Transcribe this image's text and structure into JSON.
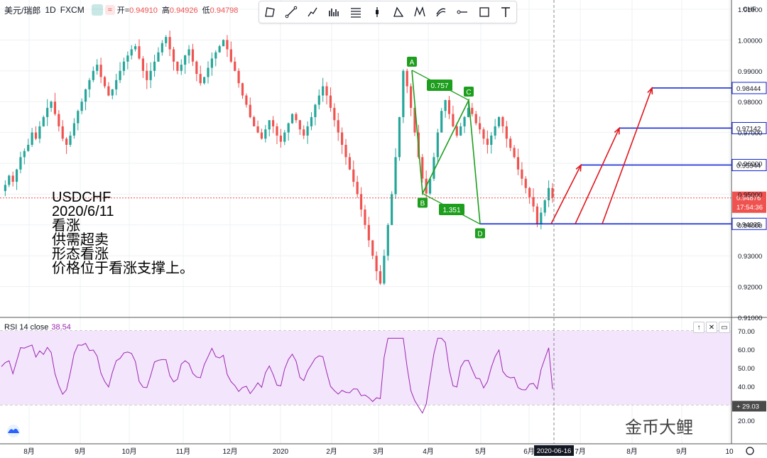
{
  "header": {
    "symbol": "美元/瑞郎",
    "interval": "1D",
    "source": "FXCM",
    "open_label": "开",
    "open": "0.94910",
    "high_label": "高",
    "high": "0.94926",
    "low_label": "低",
    "low": "0.94798",
    "dot_color": "#26a69a",
    "dot_icon_color": "#ef5350"
  },
  "toolbar": {
    "tools": [
      "rectangle-icon",
      "line-icon",
      "path-icon",
      "pattern-icon",
      "fib-icon",
      "position-icon",
      "triangle-icon",
      "xabcd-icon",
      "channel-icon",
      "horizontal-line-icon",
      "frame-icon",
      "text-icon"
    ]
  },
  "overlay_text": {
    "line1": "USDCHF",
    "line2": "2020/6/11",
    "line3": "看涨",
    "line4": "供需超卖",
    "line5": "形态看涨",
    "line6": "价格位于看涨支撑上。"
  },
  "price_axis": {
    "currency": "CHF",
    "ticks": [
      "1.01000",
      "1.00000",
      "0.99000",
      "0.98000",
      "0.97000",
      "0.96000",
      "0.95000",
      "0.94000",
      "0.93000",
      "0.92000",
      "0.91000"
    ],
    "levels": [
      {
        "label": "0.98444",
        "value": 0.98444,
        "color": "#0a1fd6"
      },
      {
        "label": "0.97142",
        "value": 0.97142,
        "color": "#0a1fd6"
      },
      {
        "label": "0.95944",
        "value": 0.95944,
        "color": "#0a1fd6"
      },
      {
        "label": "0.94035",
        "value": 0.94035,
        "color": "#0a1fd6"
      }
    ],
    "current_price": "0.94876",
    "countdown": "17:54:36",
    "current_color": "#ef5350"
  },
  "time_axis": {
    "labels": [
      "8月",
      "9月",
      "10月",
      "11月",
      "12月",
      "2020",
      "2月",
      "3月",
      "4月",
      "5月",
      "6月",
      "7月",
      "8月",
      "9月",
      "10"
    ],
    "cursor_date": "2020-06-16"
  },
  "rsi": {
    "label": "RSI 14 close",
    "value": "38.54",
    "ticks": [
      "70.00",
      "60.00",
      "50.00",
      "40.00",
      "20.00"
    ],
    "lower_band": "29.03",
    "line_color": "#9c27b0",
    "band_color": "#f3e5fc"
  },
  "harmonic": {
    "points": [
      "A",
      "B",
      "C",
      "D"
    ],
    "ratios": [
      "0.757",
      "1.351"
    ],
    "color": "#1d9e1d"
  },
  "watermark": {
    "text": "金币大鲤"
  },
  "chart_data": {
    "type": "candlestick",
    "title": "美元/瑞郎 1D FXCM",
    "ylim": [
      0.915,
      1.013
    ],
    "key_points": [
      {
        "label": "A",
        "value": 0.9902
      },
      {
        "label": "B",
        "value": 0.9502
      },
      {
        "label": "C",
        "value": 0.9805
      },
      {
        "label": "D",
        "value": 0.9403
      }
    ],
    "price_path": [
      0.951,
      0.953,
      0.956,
      0.954,
      0.958,
      0.962,
      0.964,
      0.966,
      0.97,
      0.968,
      0.972,
      0.975,
      0.978,
      0.98,
      0.976,
      0.972,
      0.968,
      0.966,
      0.969,
      0.973,
      0.977,
      0.98,
      0.984,
      0.987,
      0.99,
      0.992,
      0.988,
      0.985,
      0.982,
      0.984,
      0.987,
      0.99,
      0.993,
      0.995,
      0.997,
      0.998,
      0.994,
      0.99,
      0.987,
      0.99,
      0.993,
      0.996,
      0.999,
      1.001,
      0.997,
      0.993,
      0.99,
      0.992,
      0.995,
      0.997,
      0.993,
      0.989,
      0.986,
      0.988,
      0.991,
      0.994,
      0.996,
      0.998,
      1.0,
      0.997,
      0.993,
      0.99,
      0.986,
      0.982,
      0.979,
      0.975,
      0.972,
      0.97,
      0.968,
      0.971,
      0.974,
      0.972,
      0.969,
      0.967,
      0.97,
      0.973,
      0.976,
      0.974,
      0.971,
      0.969,
      0.972,
      0.975,
      0.979,
      0.982,
      0.985,
      0.982,
      0.978,
      0.974,
      0.97,
      0.966,
      0.962,
      0.958,
      0.954,
      0.95,
      0.945,
      0.94,
      0.935,
      0.93,
      0.925,
      0.921,
      0.93,
      0.94,
      0.95,
      0.962,
      0.975,
      0.99,
      0.985,
      0.978,
      0.97,
      0.962,
      0.955,
      0.9502,
      0.955,
      0.962,
      0.97,
      0.977,
      0.9805,
      0.976,
      0.972,
      0.969,
      0.972,
      0.975,
      0.978,
      0.976,
      0.973,
      0.971,
      0.968,
      0.966,
      0.969,
      0.972,
      0.975,
      0.972,
      0.968,
      0.965,
      0.962,
      0.958,
      0.955,
      0.952,
      0.949,
      0.946,
      0.9403,
      0.944,
      0.948,
      0.952,
      0.9488
    ]
  }
}
